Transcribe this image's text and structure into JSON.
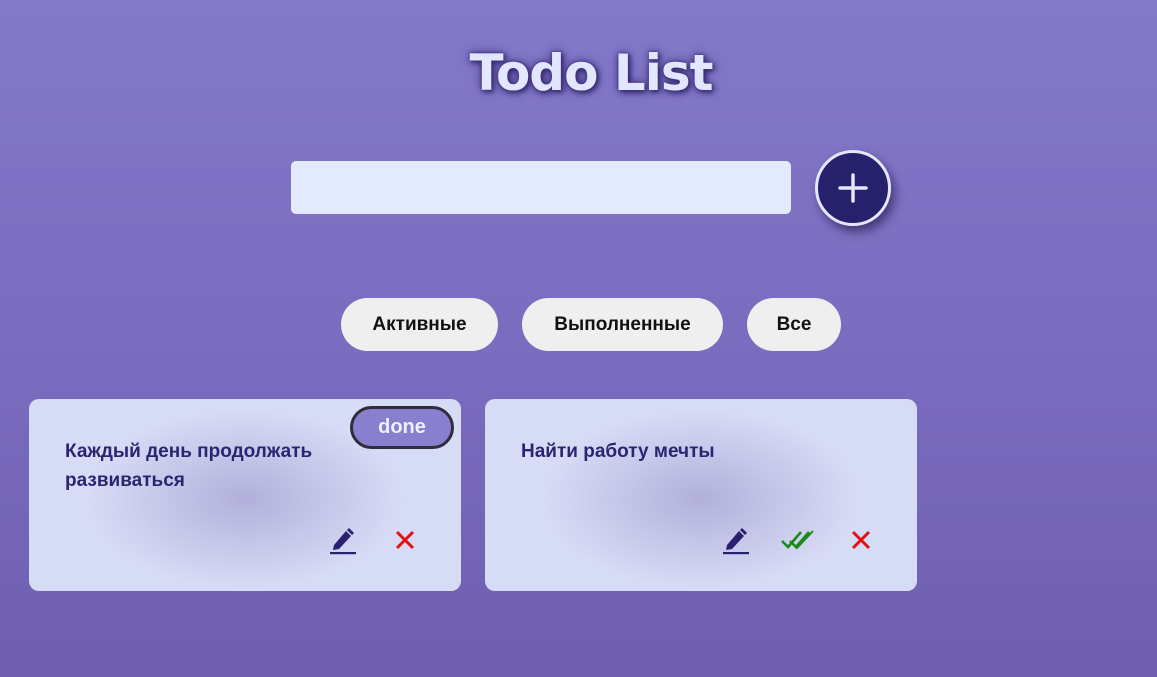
{
  "header": {
    "title": "Todo List"
  },
  "new_todo": {
    "value": "",
    "placeholder": "",
    "add_icon": "plus-icon"
  },
  "filters": [
    {
      "label": "Активные"
    },
    {
      "label": "Выполненные"
    },
    {
      "label": "Все"
    }
  ],
  "todos": [
    {
      "text": "Каждый день продолжать развиваться",
      "status_badge": "done",
      "actions": [
        "edit-icon",
        "delete-icon"
      ]
    },
    {
      "text": "Найти работу мечты",
      "status_badge": "",
      "actions": [
        "edit-icon",
        "complete-icon",
        "delete-icon"
      ]
    }
  ],
  "colors": {
    "accent": "#27206b",
    "complete": "#1a8a1a",
    "delete": "#e01010",
    "badge": "#8a7fcf"
  }
}
